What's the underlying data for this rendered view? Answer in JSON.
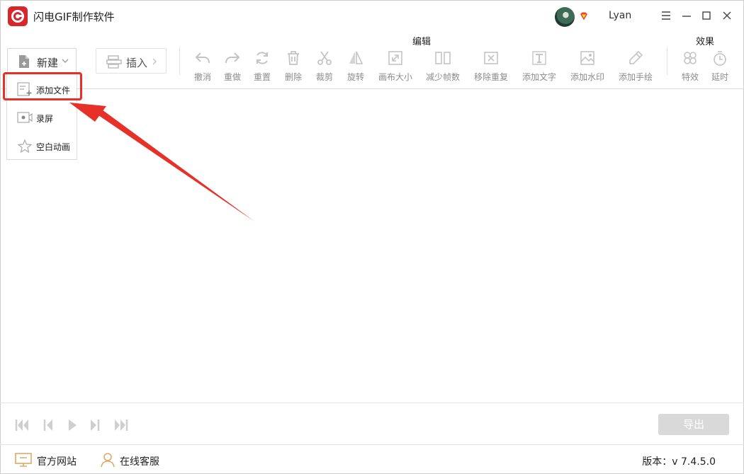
{
  "app": {
    "title": "闪电GIF制作软件"
  },
  "user": {
    "name": "Lyan"
  },
  "toolbar": {
    "new_label": "新建",
    "insert_label": "插入",
    "edit_group_label": "编辑",
    "effects_group_label": "效果",
    "tools": [
      {
        "label": "撤消",
        "icon": "undo-icon"
      },
      {
        "label": "重做",
        "icon": "redo-icon"
      },
      {
        "label": "重置",
        "icon": "reset-icon"
      },
      {
        "label": "删除",
        "icon": "trash-icon"
      },
      {
        "label": "裁剪",
        "icon": "scissors-icon"
      },
      {
        "label": "旋转",
        "icon": "rotate-icon"
      },
      {
        "label": "画布大小",
        "icon": "resize-icon"
      },
      {
        "label": "减少帧数",
        "icon": "frames-icon"
      },
      {
        "label": "移除重复",
        "icon": "remove-duplicate-icon"
      },
      {
        "label": "添加文字",
        "icon": "text-icon"
      },
      {
        "label": "添加水印",
        "icon": "watermark-icon"
      },
      {
        "label": "添加手绘",
        "icon": "pencil-icon"
      },
      {
        "label": "特效",
        "icon": "effects-icon"
      },
      {
        "label": "延时",
        "icon": "timer-icon"
      }
    ]
  },
  "new_menu": {
    "items": [
      {
        "label": "添加文件",
        "icon": "add-file-icon"
      },
      {
        "label": "录屏",
        "icon": "record-screen-icon"
      },
      {
        "label": "空白动画",
        "icon": "blank-animation-icon"
      }
    ]
  },
  "playback": {
    "export_label": "导出"
  },
  "footer": {
    "website_label": "官方网站",
    "support_label": "在线客服",
    "version_text": "版本：v 7.4.5.0"
  },
  "colors": {
    "accent_red": "#d9262b",
    "annotation_red": "#e63028",
    "disabled_gray": "#c4c4c4"
  }
}
